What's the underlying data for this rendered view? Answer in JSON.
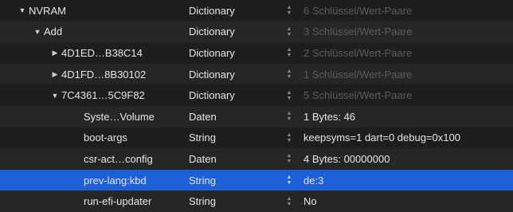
{
  "rows": [
    {
      "key": "NVRAM",
      "type": "Dictionary",
      "value": "6 Schlüssel/Wert-Paare",
      "expanded": true,
      "dim": true
    },
    {
      "key": "Add",
      "type": "Dictionary",
      "value": "3 Schlüssel/Wert-Paare",
      "expanded": true,
      "dim": true
    },
    {
      "key": "4D1ED…B38C14",
      "type": "Dictionary",
      "value": "2 Schlüssel/Wert-Paare",
      "expanded": false,
      "dim": true
    },
    {
      "key": "4D1FD…8B30102",
      "type": "Dictionary",
      "value": "1 Schlüssel/Wert-Paare",
      "expanded": false,
      "dim": true
    },
    {
      "key": "7C4361…5C9F82",
      "type": "Dictionary",
      "value": "5 Schlüssel/Wert-Paare",
      "expanded": true,
      "dim": true
    },
    {
      "key": "Syste…Volume",
      "type": "Daten",
      "value": "1 Bytes: 46",
      "dim": false
    },
    {
      "key": "boot-args",
      "type": "String",
      "value": "keepsyms=1 dart=0 debug=0x100",
      "dim": false
    },
    {
      "key": "csr-act…config",
      "type": "Daten",
      "value": "4 Bytes: 00000000",
      "dim": false
    },
    {
      "key": "prev-lang:kbd",
      "type": "String",
      "value": "de:3",
      "dim": false,
      "selected": true
    },
    {
      "key": "run-efi-updater",
      "type": "String",
      "value": "No",
      "dim": false
    }
  ],
  "icons": {
    "expanded": "▼",
    "collapsed": "▶",
    "stepper": "stepper-icon"
  },
  "colors": {
    "background": "#1e1e1e",
    "selection": "#1e5fd8",
    "dim_text": "#5c5c5c"
  }
}
